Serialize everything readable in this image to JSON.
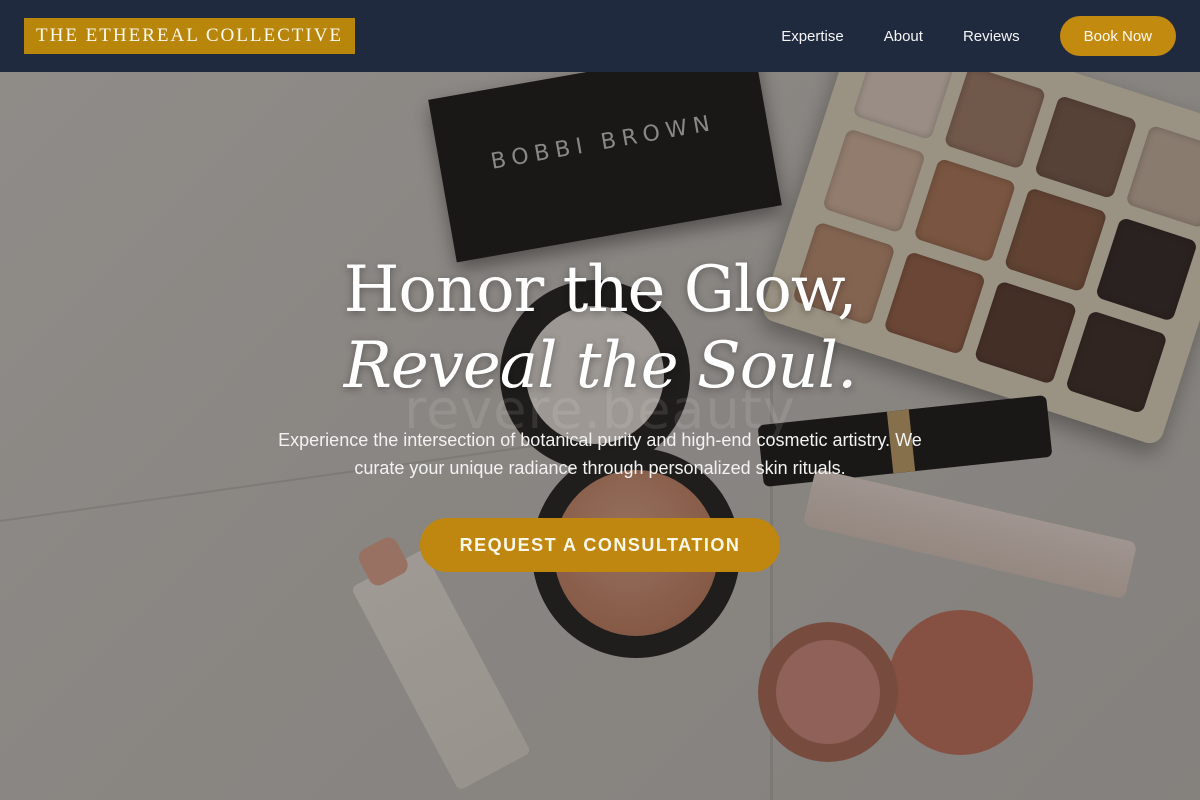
{
  "nav": {
    "brand": "THE ETHEREAL COLLECTIVE",
    "links": [
      "Expertise",
      "About",
      "Reviews"
    ],
    "cta": "Book Now"
  },
  "hero": {
    "headline_line1": "Honor the Glow,",
    "headline_line2": "Reveal the Soul.",
    "watermark": "revere.beauty",
    "subtext": "Experience the intersection of botanical purity and high-end cosmetic artistry. We curate your unique radiance through personalized skin rituals.",
    "cta": "REQUEST A CONSULTATION",
    "photo_labels": {
      "palette_brand": "BOBBI BROWN"
    }
  },
  "colors": {
    "nav_bg": "#1f2a3e",
    "gold": "#c38a10",
    "logo_bg": "#b8860b",
    "text_light": "#ffffff"
  }
}
